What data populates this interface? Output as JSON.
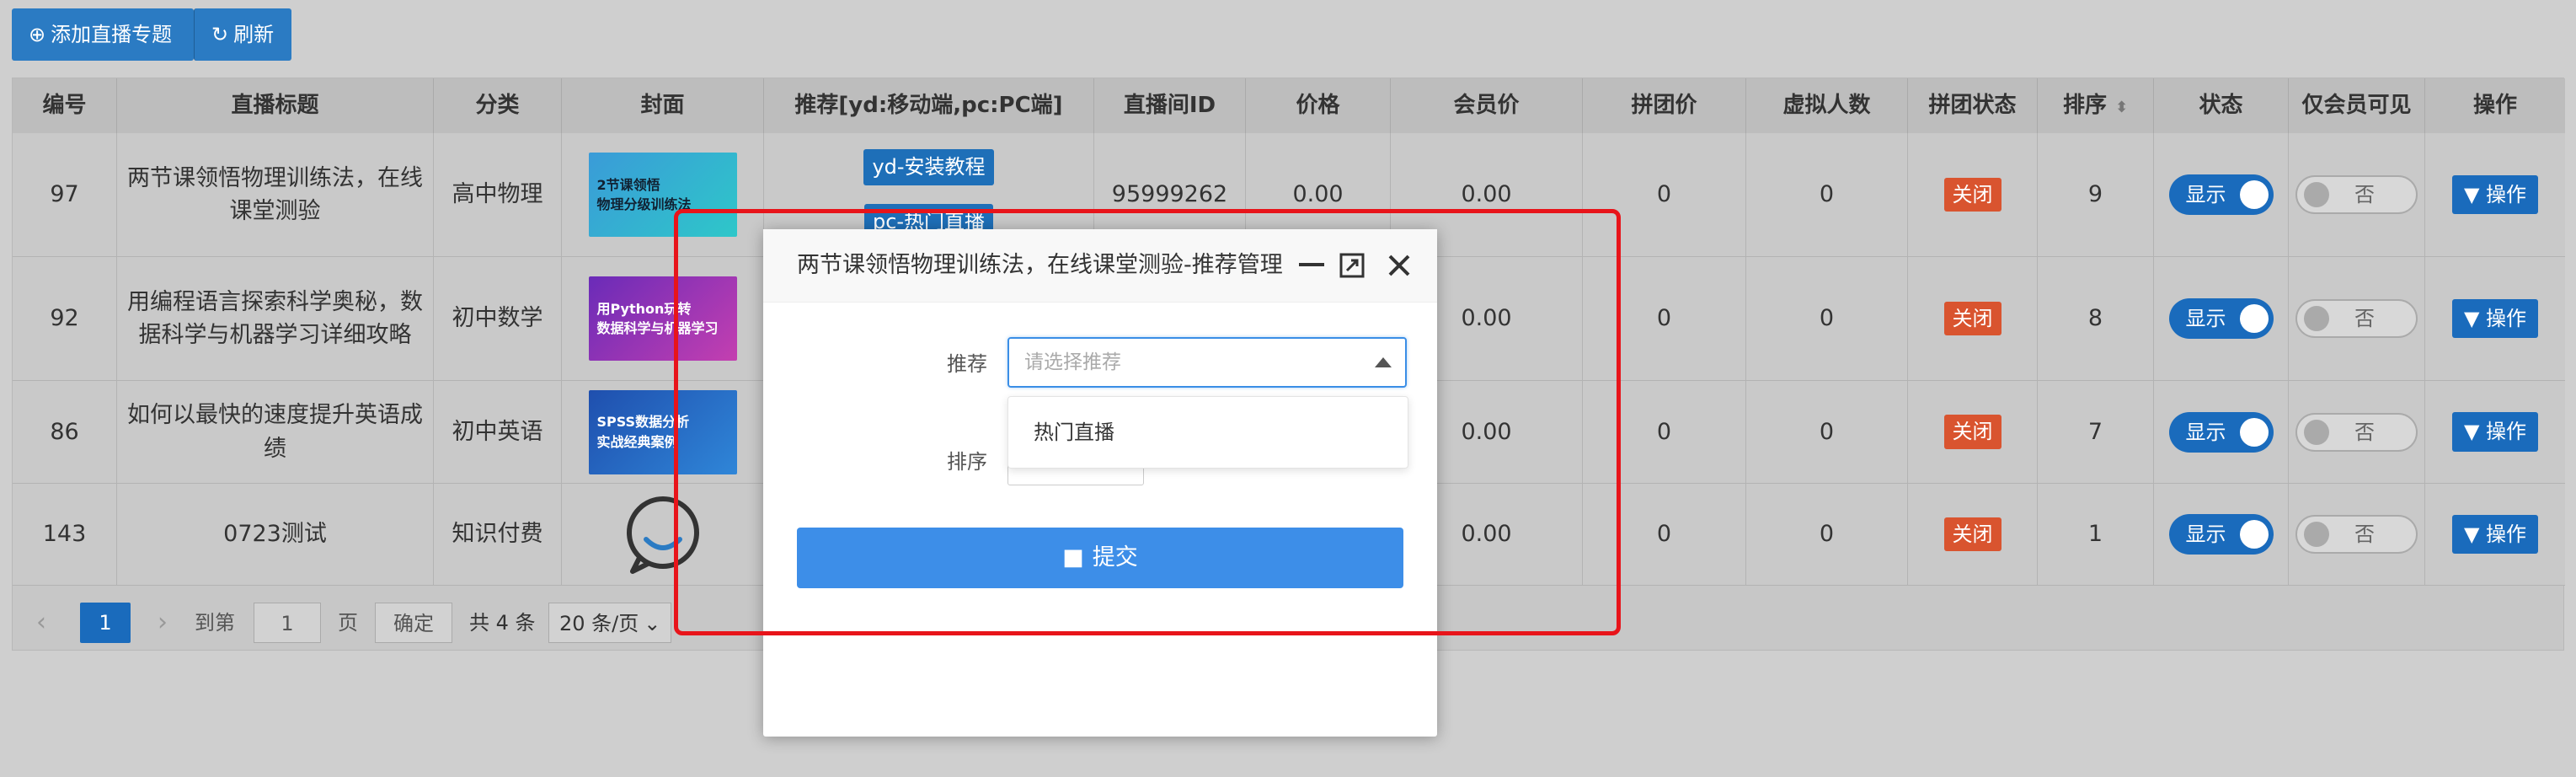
{
  "toolbar": {
    "add_label": "添加直播专题",
    "refresh_label": "刷新"
  },
  "table": {
    "headers": [
      "编号",
      "直播标题",
      "分类",
      "封面",
      "推荐[yd:移动端,pc:PC端]",
      "直播间ID",
      "价格",
      "会员价",
      "拼团价",
      "虚拟人数",
      "拼团状态",
      "排序",
      "状态",
      "仅会员可见",
      "操作"
    ],
    "rows": [
      {
        "id": "97",
        "title": "两节课领悟物理训练法，在线课堂测验",
        "category": "高中物理",
        "cover_text": "2节课领悟\n物理分级训练法",
        "rec1": "yd-安装教程",
        "rec2": "pc-热门直播",
        "room_id": "95999262",
        "price": "0.00",
        "member_price": "0.00",
        "group_price": "0",
        "virtual": "0",
        "group_status": "关闭",
        "sort": "9",
        "status": "显示",
        "member_only": "否",
        "op": "操作"
      },
      {
        "id": "92",
        "title": "用编程语言探索科学奥秘，数据科学与机器学习详细攻略",
        "category": "初中数学",
        "cover_text": "用Python玩转\n数据科学与机器学习",
        "rec1": "",
        "rec2": "",
        "room_id": "",
        "price": "",
        "member_price": "0.00",
        "group_price": "0",
        "virtual": "0",
        "group_status": "关闭",
        "sort": "8",
        "status": "显示",
        "member_only": "否",
        "op": "操作"
      },
      {
        "id": "86",
        "title": "如何以最快的速度提升英语成绩",
        "category": "初中英语",
        "cover_text": "SPSS数据分析\n实战经典案例",
        "rec1": "",
        "rec2": "",
        "room_id": "",
        "price": "",
        "member_price": "0.00",
        "group_price": "0",
        "virtual": "0",
        "group_status": "关闭",
        "sort": "7",
        "status": "显示",
        "member_only": "否",
        "op": "操作"
      },
      {
        "id": "143",
        "title": "0723测试",
        "category": "知识付费",
        "cover_text": "",
        "rec1": "",
        "rec2": "",
        "room_id": "",
        "price": "",
        "member_price": "0.00",
        "group_price": "0",
        "virtual": "0",
        "group_status": "关闭",
        "sort": "1",
        "status": "显示",
        "member_only": "否",
        "op": "操作"
      }
    ]
  },
  "pager": {
    "current": "1",
    "goto_label": "到第",
    "page_input": "1",
    "page_unit": "页",
    "confirm": "确定",
    "total": "共 4 条",
    "per_page": "20 条/页"
  },
  "modal": {
    "title": "两节课领悟物理训练法，在线课堂测验-推荐管理",
    "recommend_label": "推荐",
    "recommend_placeholder": "请选择推荐",
    "dropdown_option": "热门直播",
    "sort_label": "排序",
    "submit_label": "提交"
  },
  "colors": {
    "primary": "#3d8ee8",
    "highlight": "#e8141a",
    "tag_red": "#d9542f"
  }
}
